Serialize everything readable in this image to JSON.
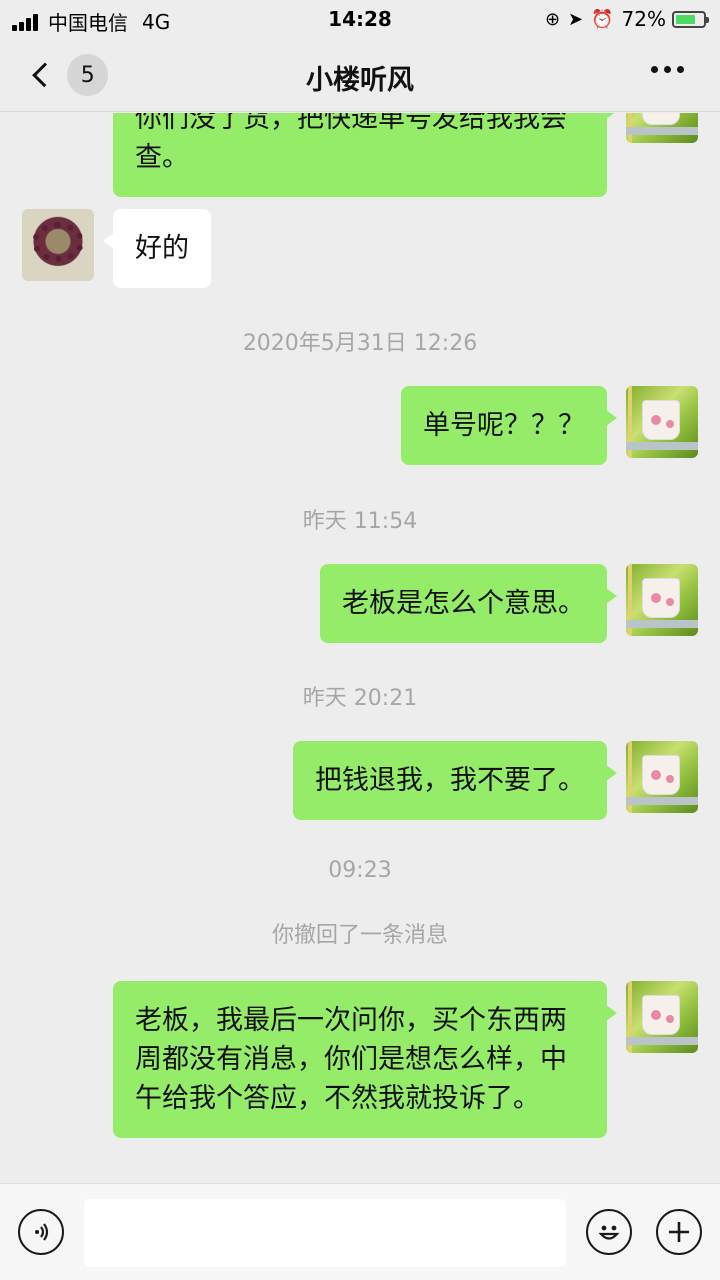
{
  "status_bar": {
    "carrier": "中国电信",
    "network": "4G",
    "time": "14:28",
    "battery": "72%",
    "battery_level": 0.72
  },
  "nav": {
    "unread_count": "5",
    "title": "小楼听风"
  },
  "messages": [
    {
      "type": "text",
      "from": "me",
      "text": "你们没了货，把快递单号发给我我会查。"
    },
    {
      "type": "text",
      "from": "other",
      "text": "好的"
    },
    {
      "type": "time",
      "text": "2020年5月31日 12:26"
    },
    {
      "type": "text",
      "from": "me",
      "text": "单号呢？？？"
    },
    {
      "type": "time",
      "text": "昨天 11:54"
    },
    {
      "type": "text",
      "from": "me",
      "text": "老板是怎么个意思。"
    },
    {
      "type": "time",
      "text": "昨天 20:21"
    },
    {
      "type": "text",
      "from": "me",
      "text": "把钱退我，我不要了。"
    },
    {
      "type": "time",
      "text": "09:23"
    },
    {
      "type": "system",
      "text": "你撤回了一条消息"
    },
    {
      "type": "text",
      "from": "me",
      "text": "老板，我最后一次问你，买个东西两周都没有消息，你们是想怎么样，中午给我个答应，不然我就投诉了。"
    }
  ],
  "input": {
    "value": ""
  },
  "colors": {
    "my_bubble": "#95ec69",
    "other_bubble": "#ffffff",
    "background": "#ededed"
  }
}
